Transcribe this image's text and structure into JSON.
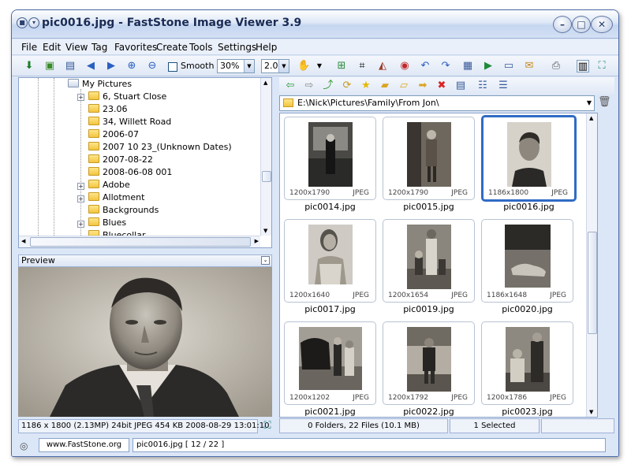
{
  "window": {
    "title": "pic0016.jpg - FastStone Image Viewer 3.9"
  },
  "menu": [
    "File",
    "Edit",
    "View",
    "Tag",
    "Favorites",
    "Create",
    "Tools",
    "Settings",
    "Help"
  ],
  "toolbar": {
    "smooth_label": "Smooth",
    "zoom_value": "30%",
    "ratio_value": "2.0"
  },
  "tree": {
    "root": "My Pictures",
    "items": [
      "6, Stuart Close",
      "23.06",
      "34, Willett Road",
      "2006-07",
      "2007 10 23_(Unknown Dates)",
      "2007-08-22",
      "2008-06-08 001",
      "Adobe",
      "Allotment",
      "Backgrounds",
      "Blues",
      "Bluecollar"
    ]
  },
  "preview": {
    "header": "Preview",
    "info": "1186 x 1800 (2.13MP)   24bit JPEG   454 KB   2008-08-29 13:01:10"
  },
  "browser": {
    "path": "E:\\Nick\\Pictures\\Family\\From Jon\\"
  },
  "thumbnails": [
    {
      "name": "pic0014.jpg",
      "dims": "1200x1790",
      "format": "JPEG"
    },
    {
      "name": "pic0015.jpg",
      "dims": "1200x1790",
      "format": "JPEG"
    },
    {
      "name": "pic0016.jpg",
      "dims": "1186x1800",
      "format": "JPEG",
      "selected": true
    },
    {
      "name": "pic0017.jpg",
      "dims": "1200x1640",
      "format": "JPEG"
    },
    {
      "name": "pic0019.jpg",
      "dims": "1200x1654",
      "format": "JPEG"
    },
    {
      "name": "pic0020.jpg",
      "dims": "1186x1648",
      "format": "JPEG"
    },
    {
      "name": "pic0021.jpg",
      "dims": "1200x1202",
      "format": "JPEG"
    },
    {
      "name": "pic0022.jpg",
      "dims": "1200x1792",
      "format": "JPEG"
    },
    {
      "name": "pic0023.jpg",
      "dims": "1200x1786",
      "format": "JPEG"
    }
  ],
  "status": {
    "files": "0 Folders, 22 Files (10.1 MB)",
    "selected": "1 Selected",
    "website": "www.FastStone.org",
    "current": "pic0016.jpg [ 12 / 22 ]"
  }
}
